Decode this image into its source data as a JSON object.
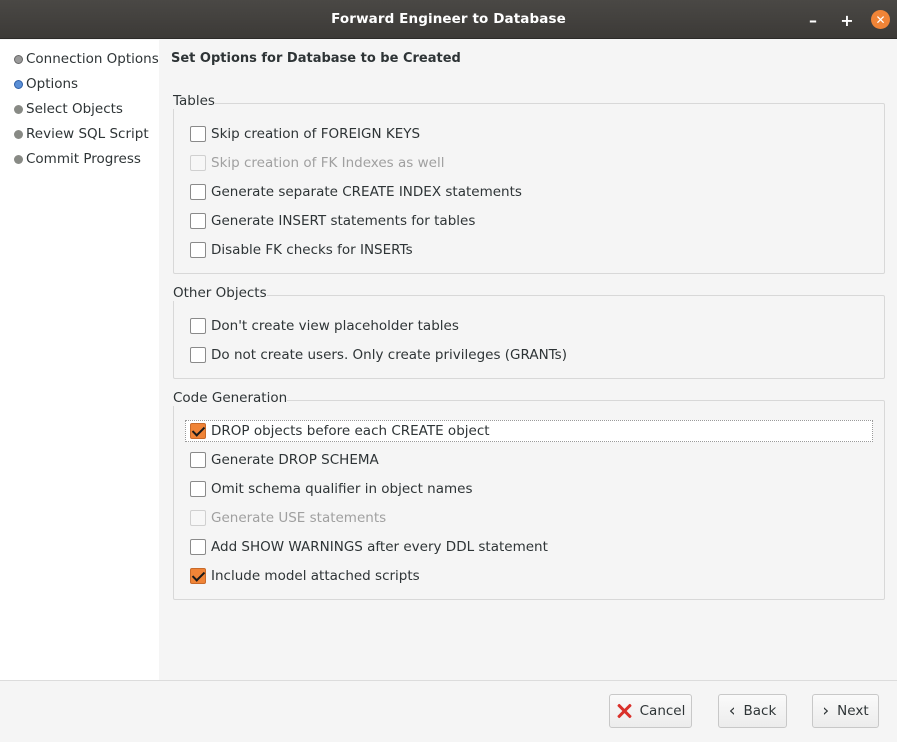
{
  "window": {
    "title": "Forward Engineer to Database",
    "controls": {
      "minimize": "–",
      "maximize": "+",
      "close": "✕"
    }
  },
  "sidebar": {
    "steps": [
      {
        "label": "Connection Options",
        "state": "done"
      },
      {
        "label": "Options",
        "state": "current"
      },
      {
        "label": "Select Objects",
        "state": "pending"
      },
      {
        "label": "Review SQL Script",
        "state": "pending"
      },
      {
        "label": "Commit Progress",
        "state": "pending"
      }
    ]
  },
  "main": {
    "heading": "Set Options for Database to be Created",
    "groups": [
      {
        "label": "Tables",
        "options": [
          {
            "label": "Skip creation of FOREIGN KEYS",
            "checked": false,
            "enabled": true
          },
          {
            "label": "Skip creation of FK Indexes as well",
            "checked": false,
            "enabled": false
          },
          {
            "label": "Generate separate CREATE INDEX statements",
            "checked": false,
            "enabled": true
          },
          {
            "label": "Generate INSERT statements for tables",
            "checked": false,
            "enabled": true
          },
          {
            "label": "Disable FK checks for INSERTs",
            "checked": false,
            "enabled": true
          }
        ]
      },
      {
        "label": "Other Objects",
        "options": [
          {
            "label": "Don't create view placeholder tables",
            "checked": false,
            "enabled": true
          },
          {
            "label": "Do not create users. Only create privileges (GRANTs)",
            "checked": false,
            "enabled": true
          }
        ]
      },
      {
        "label": "Code Generation",
        "options": [
          {
            "label": "DROP objects before each CREATE object",
            "checked": true,
            "enabled": true,
            "focused": true
          },
          {
            "label": "Generate DROP SCHEMA",
            "checked": false,
            "enabled": true
          },
          {
            "label": "Omit schema qualifier in object names",
            "checked": false,
            "enabled": true
          },
          {
            "label": "Generate USE statements",
            "checked": false,
            "enabled": false
          },
          {
            "label": "Add SHOW WARNINGS after every DDL statement",
            "checked": false,
            "enabled": true
          },
          {
            "label": "Include model attached scripts",
            "checked": true,
            "enabled": true
          }
        ]
      }
    ]
  },
  "footer": {
    "cancel_label": "Cancel",
    "back_label": "Back",
    "next_label": "Next"
  },
  "colors": {
    "accent": "#f08437",
    "titlebar": "#3f3d3a",
    "cancel_icon": "#d9302a",
    "current_step": "#5b8fd6"
  }
}
